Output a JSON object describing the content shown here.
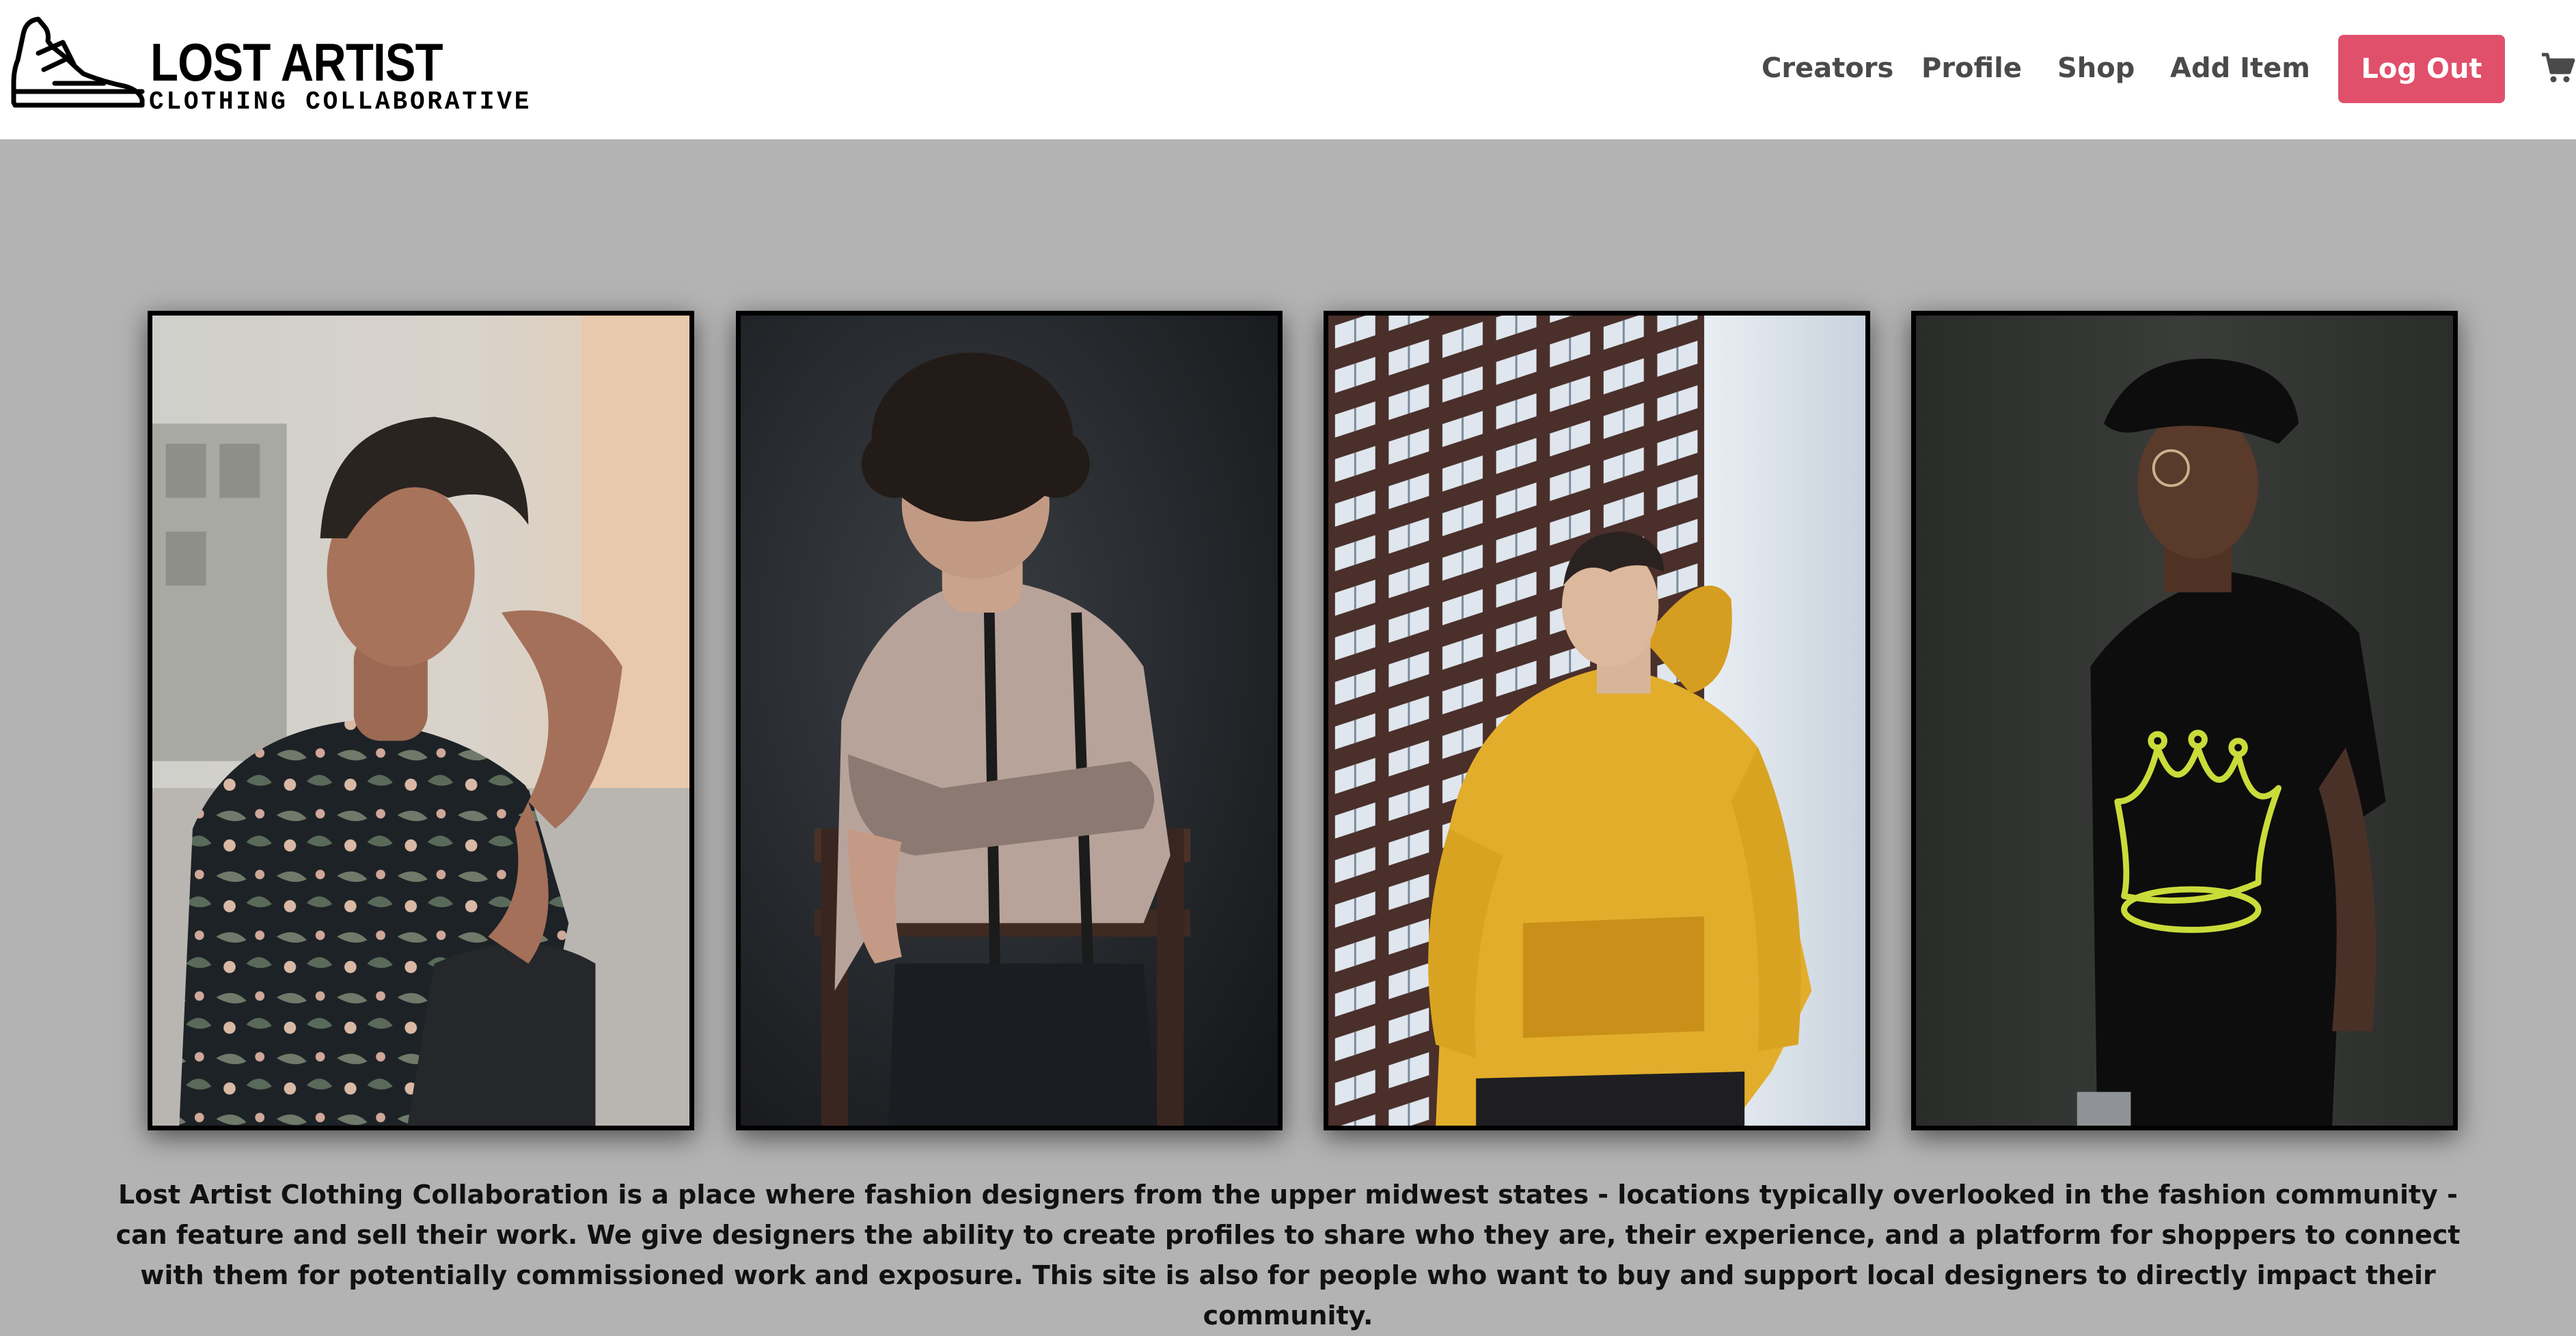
{
  "brand": {
    "title": "LOST ARTIST",
    "subtitle": "CLOTHING COLLABORATIVE",
    "logo_icon": "sneaker-icon"
  },
  "nav": {
    "items": [
      "Creators",
      "Profile",
      "Shop",
      "Add Item"
    ],
    "logout_label": "Log Out",
    "cart_icon": "cart-icon",
    "logout_color": "#e0506b"
  },
  "gallery": {
    "photos": [
      {
        "subject": "man-floral-shirt-photo"
      },
      {
        "subject": "man-chair-photo"
      },
      {
        "subject": "man-yellow-hoodie-photo"
      },
      {
        "subject": "man-crown-tee-photo"
      }
    ]
  },
  "description": {
    "text": "Lost Artist Clothing Collaboration is a place where fashion designers from the upper midwest states - locations typically overlooked in the fashion community - can feature and sell their work. We give designers the ability to create profiles to share who they are, their experience, and a platform for shoppers to connect with them for potentially commissioned work and exposure. This site is also for people who want to buy and support local designers to directly impact their community."
  },
  "colors": {
    "background": "#b3b3b3",
    "header_bg": "#ffffff",
    "nav_text": "#4a4a4a"
  }
}
